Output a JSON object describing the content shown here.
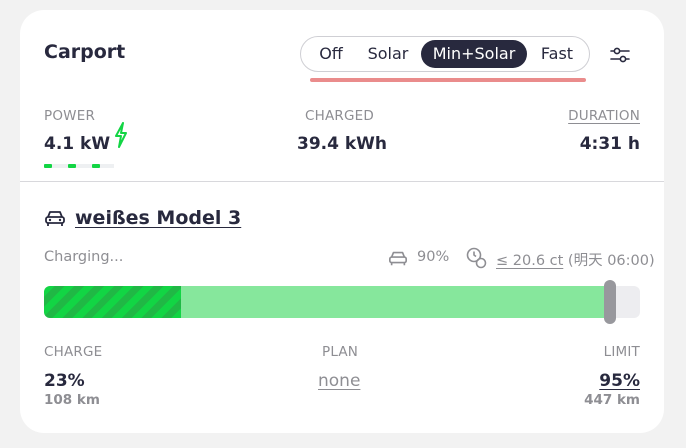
{
  "loadpoint": {
    "title": "Carport"
  },
  "modes": {
    "options": [
      "Off",
      "Solar",
      "Min+Solar",
      "Fast"
    ],
    "selected": "Min+Solar"
  },
  "stats": {
    "power_label": "POWER",
    "power_value": "4.1 kW",
    "charged_label": "CHARGED",
    "charged_value": "39.4 kWh",
    "duration_label": "DURATION",
    "duration_value": "4:31 h"
  },
  "vehicle": {
    "name": "weißes Model 3",
    "status": "Charging...",
    "vehicle_soc": "90%",
    "price_limit": "≤ 20.6 ct",
    "price_limit_time": "(明天 06:00)"
  },
  "progress": {
    "charged_fraction": 0.23,
    "limit_fraction": 0.95
  },
  "details": {
    "charge_label": "CHARGE",
    "charge_value": "23%",
    "charge_range": "108 km",
    "plan_label": "PLAN",
    "plan_value": "none",
    "limit_label": "LIMIT",
    "limit_value": "95%",
    "limit_range": "447 km"
  },
  "colors": {
    "accent_dark": "#28293e",
    "charging_green": "#12d544",
    "plan_green": "#86e79c",
    "mode_underline": "#ea8c8c"
  },
  "icons": [
    "lightning-icon",
    "settings-sliders-icon",
    "car-icon",
    "clock-coins-icon"
  ]
}
